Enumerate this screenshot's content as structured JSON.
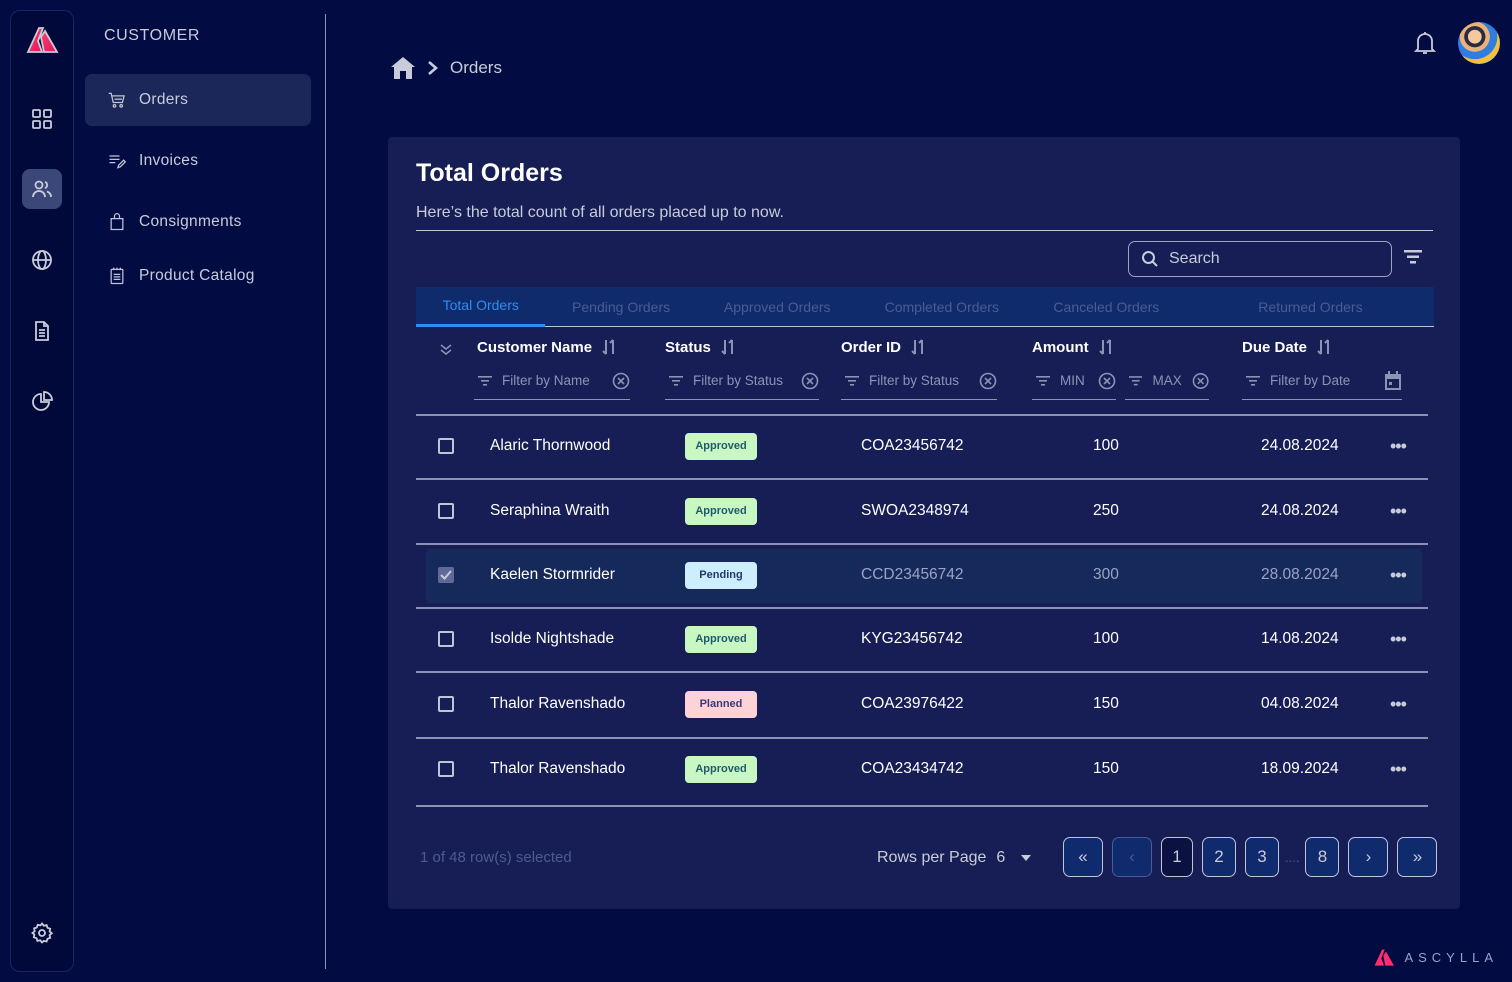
{
  "brand": {
    "name": "ASCYLLA",
    "accent": "#ff2d6f"
  },
  "rail": {
    "items": [
      {
        "icon": "dashboard-grid-icon",
        "active": false
      },
      {
        "icon": "users-icon",
        "active": true
      },
      {
        "icon": "globe-icon",
        "active": false
      },
      {
        "icon": "document-icon",
        "active": false
      },
      {
        "icon": "pie-chart-icon",
        "active": false
      }
    ],
    "bottom_icon": "settings-gear-icon"
  },
  "subnav": {
    "section_label": "CUSTOMER",
    "items": [
      {
        "label": "Orders",
        "icon": "cart-icon",
        "active": true
      },
      {
        "label": "Invoices",
        "icon": "list-edit-icon",
        "active": false
      },
      {
        "label": "Consignments",
        "icon": "bag-icon",
        "active": false
      },
      {
        "label": "Product Catalog",
        "icon": "notepad-icon",
        "active": false
      }
    ]
  },
  "breadcrumb": {
    "home_icon": "home-icon",
    "current": "Orders"
  },
  "header": {
    "notification_icon": "bell-icon",
    "avatar": "user-avatar"
  },
  "card": {
    "title": "Total Orders",
    "subtitle": "Here’s the total count of all orders placed up to now.",
    "search_placeholder": "Search",
    "tabs": [
      {
        "label": "Total Orders",
        "active": true
      },
      {
        "label": "Pending Orders",
        "active": false
      },
      {
        "label": "Approved Orders",
        "active": false
      },
      {
        "label": "Completed Orders",
        "active": false
      },
      {
        "label": "Canceled Orders",
        "active": false
      },
      {
        "label": "Returned Orders",
        "active": false
      }
    ],
    "columns": {
      "name": {
        "label": "Customer Name",
        "filter_placeholder": "Filter by Name"
      },
      "status": {
        "label": "Status",
        "filter_placeholder": "Filter by Status"
      },
      "order_id": {
        "label": "Order ID",
        "filter_placeholder": "Filter by Status"
      },
      "amount": {
        "label": "Amount",
        "min_placeholder": "MIN",
        "max_placeholder": "MAX"
      },
      "due_date": {
        "label": "Due Date",
        "filter_placeholder": "Filter by Date"
      }
    },
    "rows": [
      {
        "name": "Alaric Thornwood",
        "status": "Approved",
        "order_id": "COA23456742",
        "amount": "100",
        "due_date": "24.08.2024",
        "selected": false
      },
      {
        "name": "Seraphina Wraith",
        "status": "Approved",
        "order_id": "SWOA2348974",
        "amount": "250",
        "due_date": "24.08.2024",
        "selected": false
      },
      {
        "name": "Kaelen Stormrider",
        "status": "Pending",
        "order_id": "CCD23456742",
        "amount": "300",
        "due_date": "28.08.2024",
        "selected": true
      },
      {
        "name": "Isolde Nightshade",
        "status": "Approved",
        "order_id": "KYG23456742",
        "amount": "100",
        "due_date": "14.08.2024",
        "selected": false
      },
      {
        "name": "Thalor Ravenshado",
        "status": "Planned",
        "order_id": "COA23976422",
        "amount": "150",
        "due_date": "04.08.2024",
        "selected": false
      },
      {
        "name": "Thalor Ravenshado",
        "status": "Approved",
        "order_id": "COA23434742",
        "amount": "150",
        "due_date": "18.09.2024",
        "selected": false
      }
    ],
    "status_colors": {
      "Approved": {
        "bg": "#c9f7c4",
        "fg": "#1f5a6b"
      },
      "Pending": {
        "bg": "#cdeefc",
        "fg": "#1e3a6b"
      },
      "Planned": {
        "bg": "#fdd3d8",
        "fg": "#3a3a7a"
      }
    },
    "footer": {
      "selection_text": "1 of 48 row(s) selected",
      "rows_per_page_label": "Rows per Page",
      "rows_per_page_value": "6",
      "pages": [
        "1",
        "2",
        "3",
        "8"
      ],
      "current_page": "1",
      "ellipsis": "....",
      "first_label": "«",
      "prev_label": "‹",
      "next_label": "›",
      "last_label": "»"
    }
  }
}
